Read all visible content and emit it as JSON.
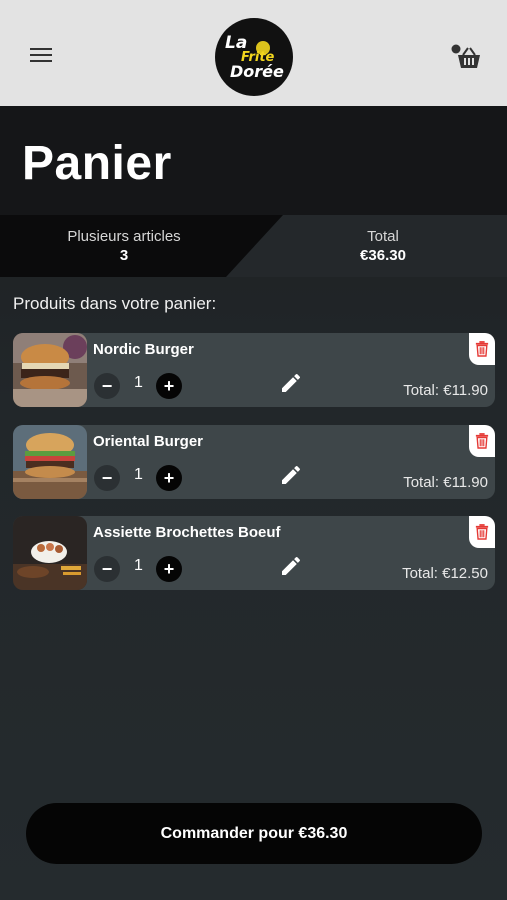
{
  "header": {
    "logo_text": [
      "La",
      "Frite",
      "Dorée"
    ]
  },
  "page": {
    "title": "Panier"
  },
  "summary": {
    "articles_label": "Plusieurs articles",
    "articles_count": "3",
    "total_label": "Total",
    "total_value": "€36.30"
  },
  "cart": {
    "section_label": "Produits dans votre panier:",
    "items": [
      {
        "name": "Nordic Burger",
        "quantity": "1",
        "total": "Total: €11.90"
      },
      {
        "name": "Oriental Burger",
        "quantity": "1",
        "total": "Total: €11.90"
      },
      {
        "name": "Assiette Brochettes Boeuf",
        "quantity": "1",
        "total": "Total: €12.50"
      }
    ],
    "minus_symbol": "−",
    "plus_symbol": "+"
  },
  "checkout": {
    "button_label": "Commander pour €36.30"
  },
  "colors": {
    "accent_logo": "#f2d61e",
    "trash_red": "#e53935",
    "button_black": "#050505"
  },
  "icons": [
    "menu-icon",
    "basket-icon",
    "edit-icon",
    "trash-icon"
  ]
}
